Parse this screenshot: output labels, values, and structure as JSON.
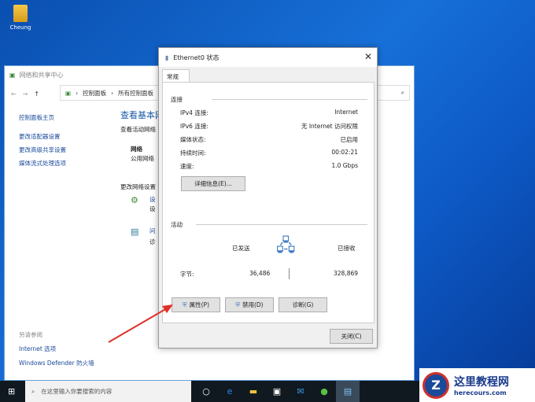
{
  "desktop": {
    "icon_label": "Cheung"
  },
  "network_window": {
    "title": "网络和共享中心",
    "breadcrumb": [
      "控制面板",
      "所有控制面板"
    ],
    "sidebar": {
      "links": [
        "控制面板主页",
        "更改适配器设置",
        "更改高级共享设置",
        "媒体流式处理选项"
      ],
      "see_also_label": "另请参阅",
      "see_also": [
        "Internet 选项",
        "Windows Defender 防火墙"
      ]
    },
    "main": {
      "heading": "查看基本网",
      "subheading": "查看活动网络",
      "network_name": "网络",
      "network_type": "公用网络",
      "change_settings": "更改网络设置",
      "item1_link": "设",
      "item1_desc": "设",
      "item2_link": "问",
      "item2_desc": "诊"
    }
  },
  "dialog": {
    "title": "Ethernet0 状态",
    "tab": "常规",
    "connection_section": "连接",
    "rows": [
      {
        "label": "IPv4 连接:",
        "value": "Internet"
      },
      {
        "label": "IPv6 连接:",
        "value": "无 Internet 访问权限"
      },
      {
        "label": "媒体状态:",
        "value": "已启用"
      },
      {
        "label": "持续时间:",
        "value": "00:02:21"
      },
      {
        "label": "速度:",
        "value": "1.0 Gbps"
      }
    ],
    "details_button": "详细信息(E)...",
    "activity_section": "活动",
    "sent_label": "已发送",
    "received_label": "已接收",
    "bytes_label": "字节:",
    "bytes_sent": "36,486",
    "bytes_received": "328,869",
    "properties_button": "属性(P)",
    "disable_button": "禁用(D)",
    "diagnose_button": "诊断(G)",
    "close_button": "关闭(C)"
  },
  "taskbar": {
    "search_placeholder": "在这里输入你要搜索的内容"
  },
  "watermark": {
    "title": "这里教程网",
    "url": "herecours.com"
  },
  "colors": {
    "arrow": "#e0302a",
    "link": "#1a4a9a"
  }
}
